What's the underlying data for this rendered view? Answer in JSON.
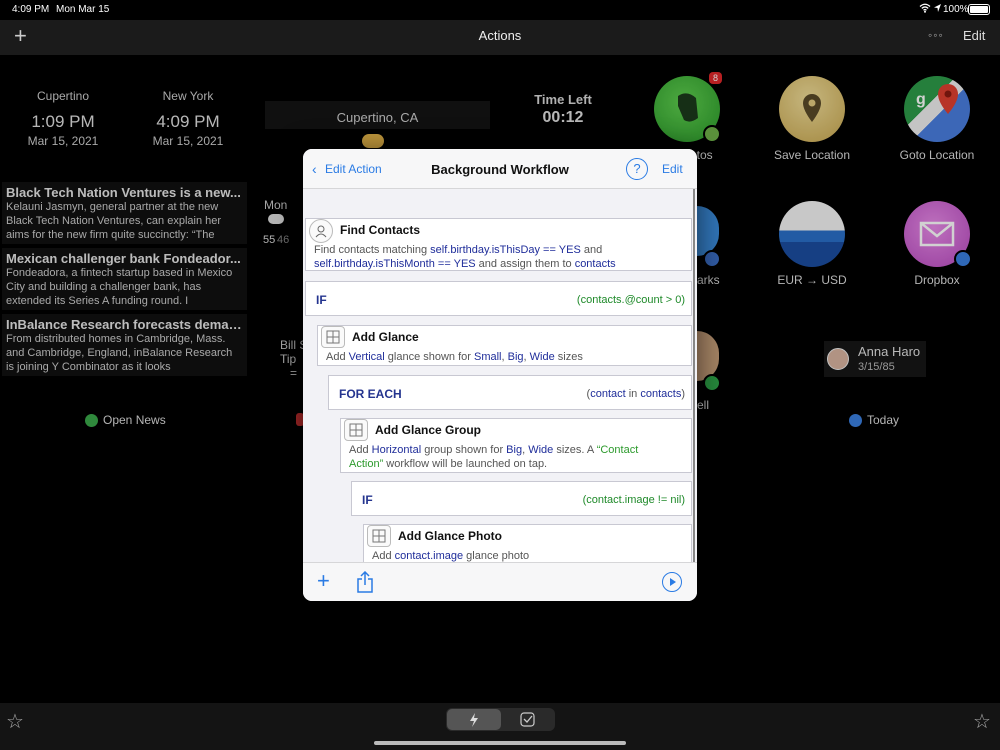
{
  "status": {
    "time": "4:09 PM",
    "date": "Mon Mar 15",
    "battery": "100%"
  },
  "nav": {
    "title": "Actions",
    "edit": "Edit",
    "more": "◦◦◦"
  },
  "clocks": [
    {
      "city": "Cupertino",
      "time": "1:09 PM",
      "date": "Mar 15, 2021"
    },
    {
      "city": "New York",
      "time": "4:09 PM",
      "date": "Mar 15, 2021"
    }
  ],
  "weather": {
    "location": "Cupertino, CA",
    "day": "Mon",
    "high": "55",
    "low": "46"
  },
  "timer": {
    "label": "Time Left",
    "value": "00:12"
  },
  "tip": {
    "line1": "Bill S",
    "line2": "Tip",
    "line3": "="
  },
  "news": [
    {
      "headline": "Black Tech Nation Ventures is a new...",
      "body": "Kelauni Jasmyn, general partner at the new Black Tech Nation Ventures, can explain her aims for the new firm quite succinctly: “The"
    },
    {
      "headline": "Mexican challenger bank Fondeador...",
      "body": "Fondeadora, a fintech startup based in Mexico City and building a challenger bank, has extended its Series A funding round. I"
    },
    {
      "headline": "InBalance Research forecasts deman...",
      "body": "From distributed homes in Cambridge, Mass. and Cambridge, England, inBalance Research is joining Y Combinator as it looks"
    }
  ],
  "open_news": "Open News",
  "apps": [
    {
      "label": "otos",
      "badge": "8"
    },
    {
      "label": "Save Location"
    },
    {
      "label": "Goto Location"
    },
    {
      "label": "arks"
    },
    {
      "label": "EUR → USD"
    },
    {
      "label": "Dropbox"
    },
    {
      "label": "ell"
    }
  ],
  "contact": {
    "name": "Anna Haro",
    "date": "3/15/85"
  },
  "today": "Today",
  "modal": {
    "back": "Edit Action",
    "title": "Background Workflow",
    "help": "?",
    "edit": "Edit",
    "blocks": {
      "find": {
        "title": "Find Contacts",
        "d1": "Find contacts matching ",
        "d1k": "self.birthday.isThisDay == YES",
        "d1e": " and",
        "d2k": "self.birthday.isThisMonth == YES",
        "d2m": " and assign them to ",
        "d2v": "contacts"
      },
      "if1": {
        "kw": "IF",
        "cond": "(contacts.@count > 0)"
      },
      "glance": {
        "title": "Add Glance",
        "p1": "Add ",
        "k1": "Vertical",
        "p2": " glance shown for ",
        "k2": "Small",
        "p3": ", ",
        "k3": "Big",
        "p4": ", ",
        "k4": "Wide",
        "p5": " sizes"
      },
      "foreach": {
        "kw": "FOR EACH",
        "c1": "(",
        "c2": "contact",
        "c3": " in ",
        "c4": "contacts",
        "c5": ")"
      },
      "group": {
        "title": "Add Glance Group",
        "p1": "Add ",
        "k1": "Horizontal",
        "p2": " group shown for ",
        "k2": "Big",
        "p3": ", ",
        "k3": "Wide",
        "p4": " sizes. A ",
        "s1": "“Contact",
        "s2": "Action”",
        "p5": " workflow will be launched on tap."
      },
      "if2": {
        "kw": "IF",
        "cond": "(contact.image != nil)"
      },
      "photo": {
        "title": "Add Glance Photo",
        "p1": "Add ",
        "k1": "contact.image",
        "p2": " glance photo"
      }
    }
  },
  "colors": {
    "accent": "#2a7be4",
    "keyword": "#1f2d9a",
    "string": "#2c9a2c"
  }
}
